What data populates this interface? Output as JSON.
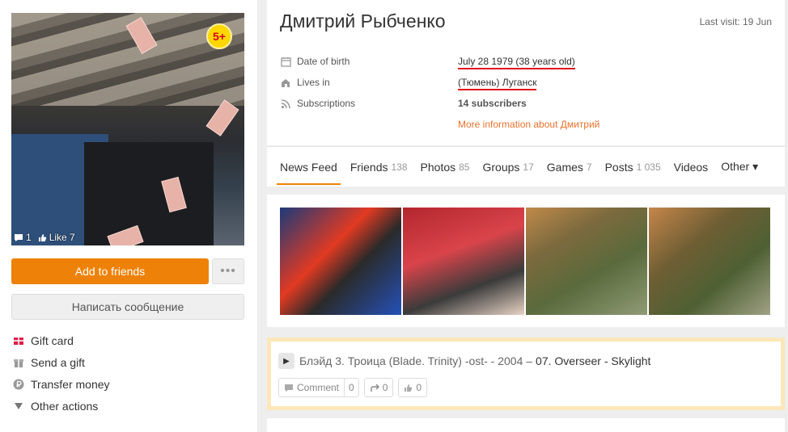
{
  "profile": {
    "name": "Дмитрий Рыбченко",
    "last_visit": "Last visit: 19 Jun",
    "badge": "5+",
    "avatar_comments": "1",
    "avatar_likes": "Like 7"
  },
  "info": {
    "dob_label": "Date of birth",
    "dob_value": "July 28 1979 (38 years old)",
    "lives_label": "Lives in",
    "lives_value": "(Тюмень) Луганск",
    "subs_label": "Subscriptions",
    "subs_value": "14 subscribers",
    "more_link": "More information about Дмитрий"
  },
  "buttons": {
    "add_friends": "Add to friends",
    "more": "•••",
    "message": "Написать сообщение"
  },
  "actions": [
    {
      "label": "Gift card",
      "icon": "gift-card-icon"
    },
    {
      "label": "Send a gift",
      "icon": "gift-icon"
    },
    {
      "label": "Transfer money",
      "icon": "ruble-icon"
    },
    {
      "label": "Other actions",
      "icon": "triangle-down-icon"
    }
  ],
  "tabs": [
    {
      "label": "News Feed",
      "count": ""
    },
    {
      "label": "Friends",
      "count": "138"
    },
    {
      "label": "Photos",
      "count": "85"
    },
    {
      "label": "Groups",
      "count": "17"
    },
    {
      "label": "Games",
      "count": "7"
    },
    {
      "label": "Posts",
      "count": "1 035"
    },
    {
      "label": "Videos",
      "count": ""
    },
    {
      "label": "Other ▾",
      "count": ""
    }
  ],
  "music": {
    "artist": "Блэйд 3. Троица (Blade. Trinity) -ost- - 2004 –",
    "song": "07. Overseer - Skylight",
    "comment_label": "Comment",
    "comment_count": "0",
    "share_count": "0",
    "like_count": "0"
  },
  "colors": {
    "accent": "#ee8208",
    "link": "#eb722e",
    "underline": "#e0141e",
    "highlight_border": "#fbe7b9"
  }
}
